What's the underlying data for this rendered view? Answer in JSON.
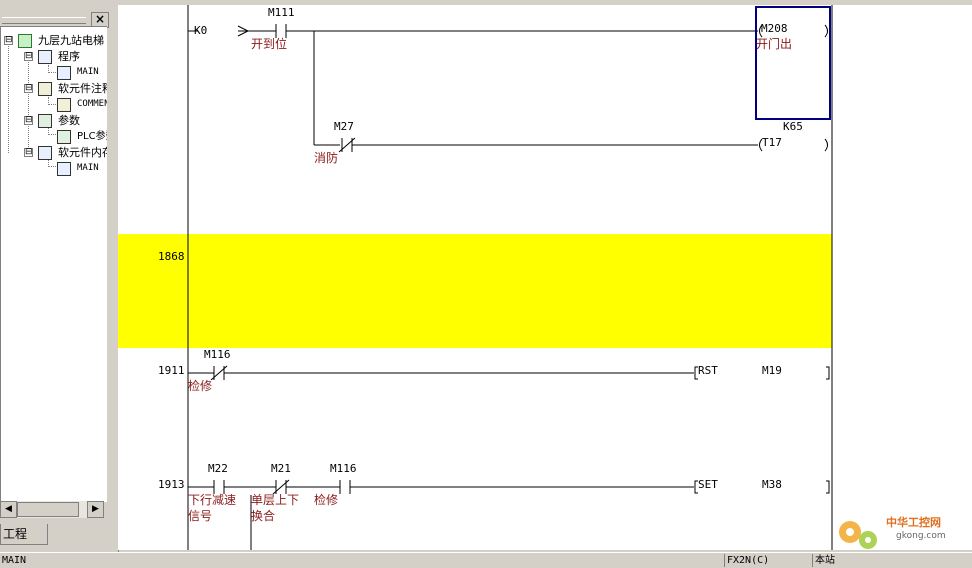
{
  "project_panel": {
    "close_label": "×",
    "tree": [
      {
        "label": "九层九站电梯",
        "level": 0,
        "expander": "⊟",
        "icon": "project-icon"
      },
      {
        "label": "程序",
        "level": 1,
        "expander": "⊟",
        "icon": "program-icon"
      },
      {
        "label": "MAIN",
        "level": 2,
        "icon": "ladder-file-icon"
      },
      {
        "label": "软元件注释",
        "level": 1,
        "expander": "⊟",
        "icon": "comment-icon"
      },
      {
        "label": "COMMENT",
        "level": 2,
        "icon": "comment-file-icon"
      },
      {
        "label": "参数",
        "level": 1,
        "expander": "⊟",
        "icon": "parameter-icon"
      },
      {
        "label": "PLC参数",
        "level": 2,
        "icon": "plc-param-icon"
      },
      {
        "label": "软元件内存",
        "level": 1,
        "expander": "⊟",
        "icon": "memory-icon"
      },
      {
        "label": "MAIN",
        "level": 2,
        "icon": "memory-file-icon"
      }
    ],
    "tab_label": "工程"
  },
  "ladder": {
    "rungs": [
      {
        "step": "",
        "elements": [
          {
            "kind": "const",
            "label": "K0"
          },
          {
            "kind": "contact_no",
            "device": "M111",
            "comment": "开到位"
          },
          {
            "kind": "coil",
            "device": "M208",
            "comment": "开门出"
          },
          {
            "kind": "contact_nc",
            "device": "M27",
            "comment": "消防"
          },
          {
            "kind": "timer",
            "device": "T17",
            "setting": "K65"
          }
        ]
      },
      {
        "step": "1868",
        "highlight": true
      },
      {
        "step": "1911",
        "elements": [
          {
            "kind": "contact_nc",
            "device": "M116",
            "comment": "检修"
          },
          {
            "kind": "instruction",
            "op": "RST",
            "operand": "M19"
          }
        ]
      },
      {
        "step": "1913",
        "elements": [
          {
            "kind": "contact_no",
            "device": "M22",
            "comment1": "下行减速",
            "comment2": "信号"
          },
          {
            "kind": "contact_nc",
            "device": "M21",
            "comment1": "单层上下",
            "comment2": "换合"
          },
          {
            "kind": "contact_no",
            "device": "M116",
            "comment1": "检修"
          },
          {
            "kind": "instruction",
            "op": "SET",
            "operand": "M38"
          }
        ]
      }
    ],
    "highlight_color": "#ffff00",
    "cursor_color": "#000080",
    "comment_color": "#8b1a1a"
  },
  "status_bar": {
    "program": "MAIN",
    "plc_type": "FX2N(C)",
    "station": "本站"
  },
  "watermark": {
    "text": "中华工控网",
    "domain": "gkong.com"
  }
}
